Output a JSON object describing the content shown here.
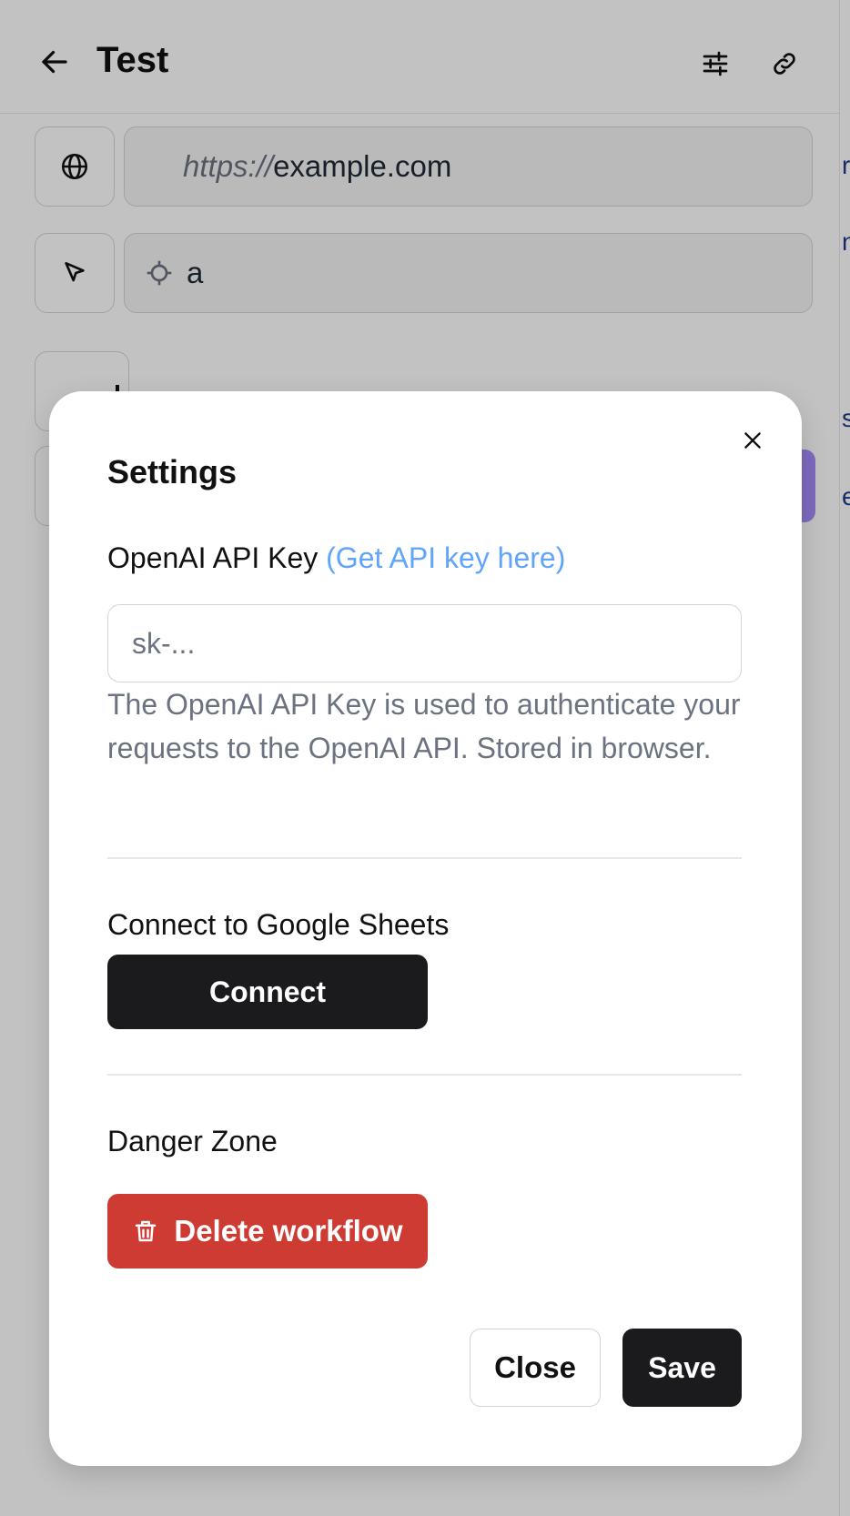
{
  "app": {
    "title": "Test",
    "url_prefix": "https://",
    "url_value": "example.com",
    "selector_value": "a",
    "edge_texts": [
      "r",
      "n",
      "s",
      "e"
    ]
  },
  "settings_modal": {
    "title": "Settings",
    "api_key_label": "OpenAI API Key",
    "api_key_link": "(Get API key here)",
    "api_key_placeholder": "sk-...",
    "api_key_help": "The OpenAI API Key is used to authenticate your requests to the OpenAI API. Stored in browser.",
    "sheets_label": "Connect to Google Sheets",
    "connect_button": "Connect",
    "danger_label": "Danger Zone",
    "delete_button": "Delete workflow",
    "close_button": "Close",
    "save_button": "Save"
  },
  "colors": {
    "link": "#60a5fa",
    "danger": "#cd3b33",
    "primary_dark": "#1b1b1e",
    "accent_purple": "#a78bfa"
  },
  "icons": [
    "back-arrow-icon",
    "sliders-icon",
    "link-icon",
    "globe-icon",
    "cursor-icon",
    "crosshair-icon",
    "plus-icon",
    "close-icon",
    "trash-icon"
  ]
}
